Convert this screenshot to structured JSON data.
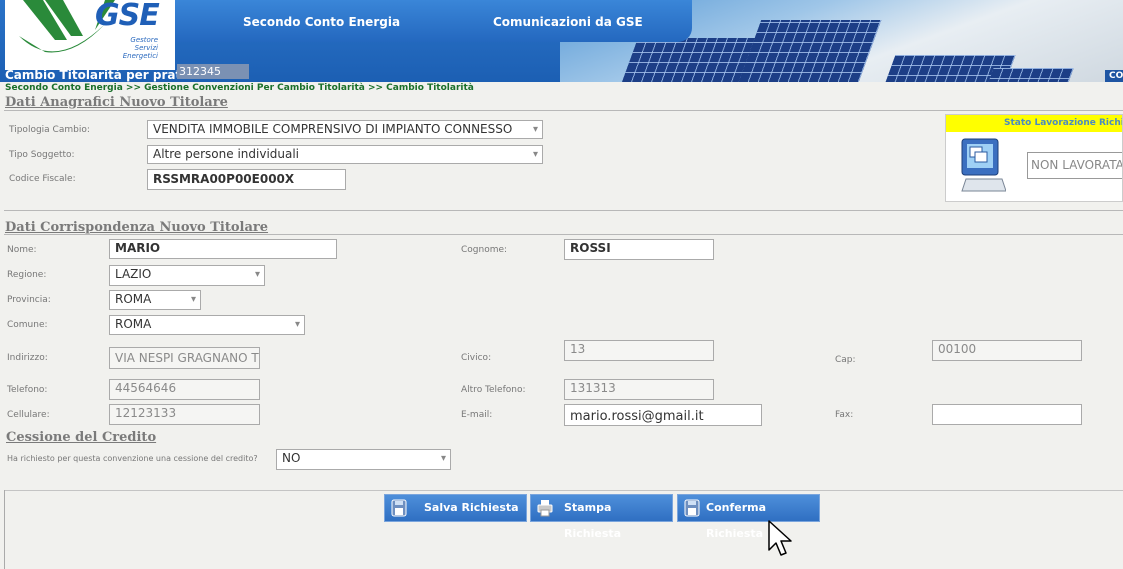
{
  "header": {
    "logo": "GSE",
    "logo_subtitle": "Gestore Servizi Energetici",
    "nav_items": [
      "Secondo Conto Energia",
      "Comunicazioni da GSE"
    ],
    "page_title": "Cambio Titolarità per pratica",
    "practice_number": "312345",
    "corner_text": "CO"
  },
  "breadcrumb": "Secondo Conto Energia >> Gestione Convenzioni Per Cambio Titolarità >> Cambio Titolarità",
  "anagrafici": {
    "title": "Dati Anagrafici Nuovo Titolare",
    "tipologia_label": "Tipologia Cambio:",
    "tipologia_value": "VENDITA IMMOBILE COMPRENSIVO DI IMPIANTO CONNESSO",
    "soggetto_label": "Tipo Soggetto:",
    "soggetto_value": "Altre persone individuali",
    "cf_label": "Codice Fiscale:",
    "cf_value": "RSSMRA00P00E000X"
  },
  "status": {
    "header": "Stato Lavorazione Richiesta",
    "value": "NON LAVORATA"
  },
  "corrispondenza": {
    "title": "Dati Corrispondenza Nuovo Titolare",
    "nome_label": "Nome:",
    "nome_value": "MARIO",
    "cognome_label": "Cognome:",
    "cognome_value": "ROSSI",
    "regione_label": "Regione:",
    "regione_value": "LAZIO",
    "provincia_label": "Provincia:",
    "provincia_value": "ROMA",
    "comune_label": "Comune:",
    "comune_value": "ROMA",
    "indirizzo_label": "Indirizzo:",
    "indirizzo_value": "VIA NESPI GRAGNANO TREBBIA",
    "civico_label": "Civico:",
    "civico_value": "13",
    "cap_label": "Cap:",
    "cap_value": "00100",
    "telefono_label": "Telefono:",
    "telefono_value": "44564646",
    "altro_tel_label": "Altro Telefono:",
    "altro_tel_value": "131313",
    "cellulare_label": "Cellulare:",
    "cellulare_value": "12123133",
    "email_label": "E-mail:",
    "email_value": "mario.rossi@gmail.it",
    "fax_label": "Fax:",
    "fax_value": ""
  },
  "cessione": {
    "title": "Cessione del Credito",
    "question": "Ha richiesto per questa convenzione una cessione del credito?",
    "value": "NO"
  },
  "buttons": {
    "salva": "Salva Richiesta",
    "stampa": "Stampa Richiesta",
    "conferma": "Conferma Richiesta"
  },
  "colors": {
    "header_blue": "#2468bf",
    "breadcrumb_green": "#1a6f2a",
    "status_yellow": "#ffff00",
    "button_blue": "#3a7acb"
  }
}
